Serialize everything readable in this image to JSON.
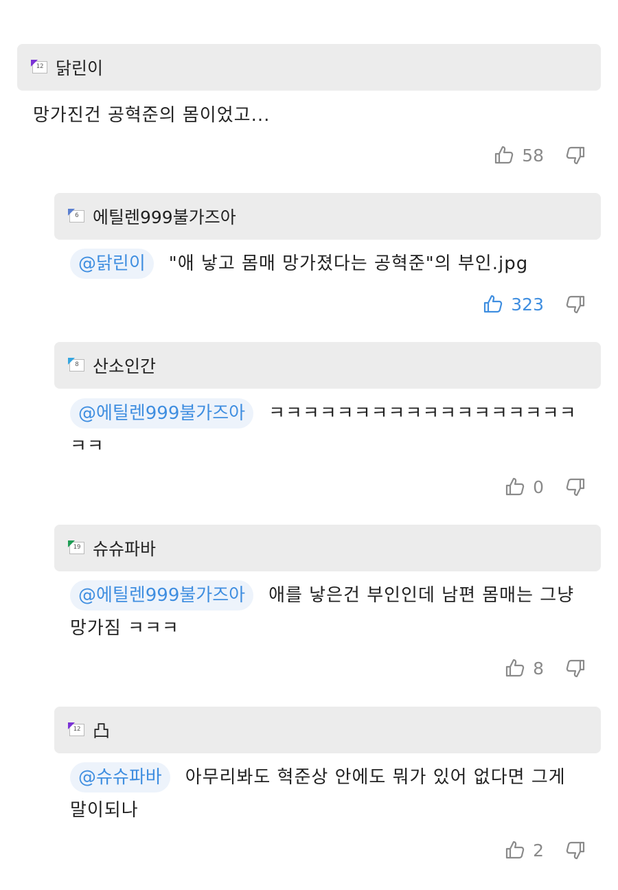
{
  "comments": [
    {
      "level": "12",
      "level_color": "#7b33d6",
      "nickname": "닭린이",
      "mention": "",
      "text": "망가진건 공혁준의 몸이었고...",
      "likes": "58",
      "liked": false
    },
    {
      "level": "6",
      "level_color": "#5a7fd0",
      "nickname": "에틸렌999불가즈아",
      "mention": "@닭린이",
      "text": "\"애 낳고 몸매 망가졌다는 공혁준\"의 부인.jpg",
      "likes": "323",
      "liked": true
    },
    {
      "level": "8",
      "level_color": "#35a6e0",
      "nickname": "산소인간",
      "mention": "@에틸렌999불가즈아",
      "text": "ㅋㅋㅋㅋㅋㅋㅋㅋㅋㅋㅋㅋㅋㅋㅋㅋㅋㅋㅋㅋ",
      "likes": "0",
      "liked": false
    },
    {
      "level": "19",
      "level_color": "#1f9d55",
      "nickname": "슈슈파바",
      "mention": "@에틸렌999불가즈아",
      "text": "애를 낳은건 부인인데 남편 몸매는 그냥 망가짐 ㅋㅋㅋ",
      "likes": "8",
      "liked": false
    },
    {
      "level": "12",
      "level_color": "#7b33d6",
      "nickname": "凸",
      "mention": "@슈슈파바",
      "text": "아무리봐도 혁준상 안에도 뭐가 있어 없다면 그게 말이되나",
      "likes": "2",
      "liked": false
    }
  ],
  "icons": {
    "like": "thumbs-up-icon",
    "dislike": "thumbs-down-icon"
  },
  "colors": {
    "accent": "#3f8ee0",
    "header_bg": "#ececec",
    "mention_bg": "#edf3fb"
  }
}
